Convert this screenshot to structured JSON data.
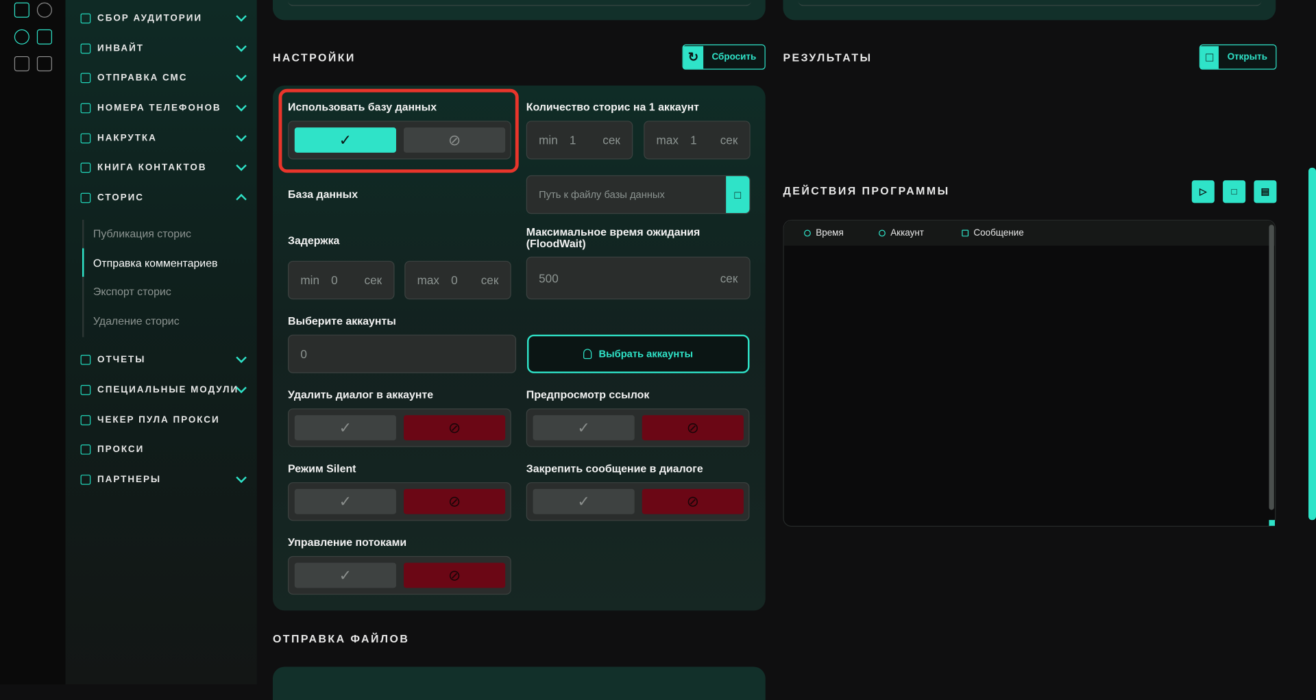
{
  "sidebar": {
    "items": [
      {
        "label": "СБОР АУДИТОРИИ"
      },
      {
        "label": "ИНВАЙТ"
      },
      {
        "label": "ОТПРАВКА СМС"
      },
      {
        "label": "НОМЕРА ТЕЛЕФОНОВ"
      },
      {
        "label": "НАКРУТКА"
      },
      {
        "label": "КНИГА КОНТАКТОВ"
      },
      {
        "label": "СТОРИС"
      },
      {
        "label": "ОТЧЕТЫ"
      },
      {
        "label": "СПЕЦИАЛЬНЫЕ МОДУЛИ"
      },
      {
        "label": "ЧЕКЕР ПУЛА ПРОКСИ"
      },
      {
        "label": "ПРОКСИ"
      },
      {
        "label": "ПАРТНЕРЫ"
      }
    ],
    "stories_sub": [
      {
        "label": "Публикация сторис"
      },
      {
        "label": "Отправка комментариев",
        "active": true
      },
      {
        "label": "Экспорт сторис"
      },
      {
        "label": "Удаление сторис"
      }
    ]
  },
  "settings": {
    "title": "НАСТРОЙКИ",
    "reset_label": "Сбросить",
    "use_db_label": "Использовать базу данных",
    "stories_count_label": "Количество сторис на 1 аккаунт",
    "stories_min_key": "min",
    "stories_min_val": "1",
    "stories_max_key": "max",
    "stories_max_val": "1",
    "unit": "сек",
    "db_label": "База данных",
    "db_placeholder": "Путь к файлу базы данных",
    "delay_label": "Задержка",
    "delay_min_key": "min",
    "delay_min_val": "0",
    "delay_max_key": "max",
    "delay_max_val": "0",
    "floodwait_label": "Максимальное время ожидания (FloodWait)",
    "floodwait_val": "500",
    "accounts_label": "Выберите аккаунты",
    "accounts_val": "0",
    "choose_accounts_label": "Выбрать аккаунты",
    "delete_dialog_label": "Удалить диалог в аккаунте",
    "link_preview_label": "Предпросмотр ссылок",
    "silent_label": "Режим Silent",
    "pin_label": "Закрепить сообщение в диалоге",
    "threads_label": "Управление потоками"
  },
  "files": {
    "title": "ОТПРАВКА ФАЙЛОВ"
  },
  "results": {
    "title": "РЕЗУЛЬТАТЫ",
    "open_label": "Открыть"
  },
  "actions": {
    "title": "ДЕЙСТВИЯ ПРОГРАММЫ",
    "col_time": "Время",
    "col_account": "Аккаунт",
    "col_message": "Сообщение"
  },
  "colors": {
    "accent": "#2fe3c8",
    "danger": "#6b0715",
    "highlight": "#e8352b"
  }
}
